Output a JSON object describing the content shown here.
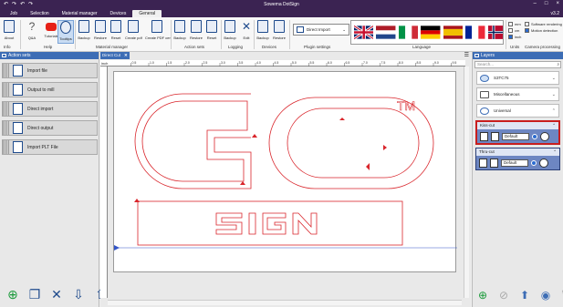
{
  "app": {
    "title": "Sowema DotSign",
    "version": "v3.2",
    "window_controls": [
      "–",
      "□",
      "×"
    ],
    "quick_access": [
      "↶",
      "↷",
      "↶",
      "↷"
    ]
  },
  "menu": [
    "Job",
    "Selection",
    "Material manager",
    "Devices",
    "General"
  ],
  "menu_active": "General",
  "ribbon": {
    "buttons": [
      "About",
      "Q&A",
      "Tutorials",
      "Tooltips",
      "Backup",
      "Restore",
      "Reset",
      "Create pdf",
      "Create PDF cert",
      "Backup",
      "Restore",
      "Reset",
      "Backup",
      "Edit",
      "Backup",
      "Restore"
    ],
    "groups": [
      "Info",
      "Help",
      "Material manager",
      "Action sets",
      "Logging",
      "Devices",
      "Plugin settings",
      "Language",
      "Units",
      "Camera processing"
    ],
    "plugin_dropdown": "Direct Import",
    "units": [
      "mm",
      "cm",
      "inch"
    ],
    "units_selected": "inch",
    "camera_options": [
      "Software rendering",
      "Motion detection"
    ]
  },
  "left_panel": {
    "title": "Action sets",
    "items": [
      "Import file",
      "Output to mill",
      "Direct import",
      "Direct output",
      "Import PLT File"
    ],
    "footer_icons": [
      "add-icon",
      "copy-icon",
      "tools-icon",
      "import-icon",
      "export-icon",
      "trash-icon"
    ]
  },
  "canvas": {
    "tab_label": "Direct Cut",
    "tab_close": "✕",
    "ruler_unit": "inch",
    "ruler_ticks": [
      "0.5",
      "1.0",
      "1.5",
      "2.0",
      "2.5",
      "3.0",
      "3.5",
      "4.0",
      "4.5",
      "5.0",
      "5.5",
      "6.0",
      "6.5",
      "7.0",
      "7.5",
      "8.0",
      "8.5",
      "9.0",
      "9.5"
    ],
    "trademark": "TM"
  },
  "right_panel": {
    "title": "Layers",
    "search_placeholder": "Search...",
    "groups": [
      "S3TC75",
      "Miscellaneous",
      "Universal"
    ],
    "layers": [
      {
        "name": "Kiss-cut",
        "setting": "Default"
      },
      {
        "name": "Thru-cut",
        "setting": "Default"
      }
    ],
    "footer_icons": [
      "add-icon",
      "visibility-icon",
      "layer-up-icon",
      "layer-icon",
      "trash-icon"
    ]
  },
  "colors": {
    "accent": "#3b2352",
    "panel_header": "#3d6db5",
    "cut_line": "#d9252b"
  }
}
